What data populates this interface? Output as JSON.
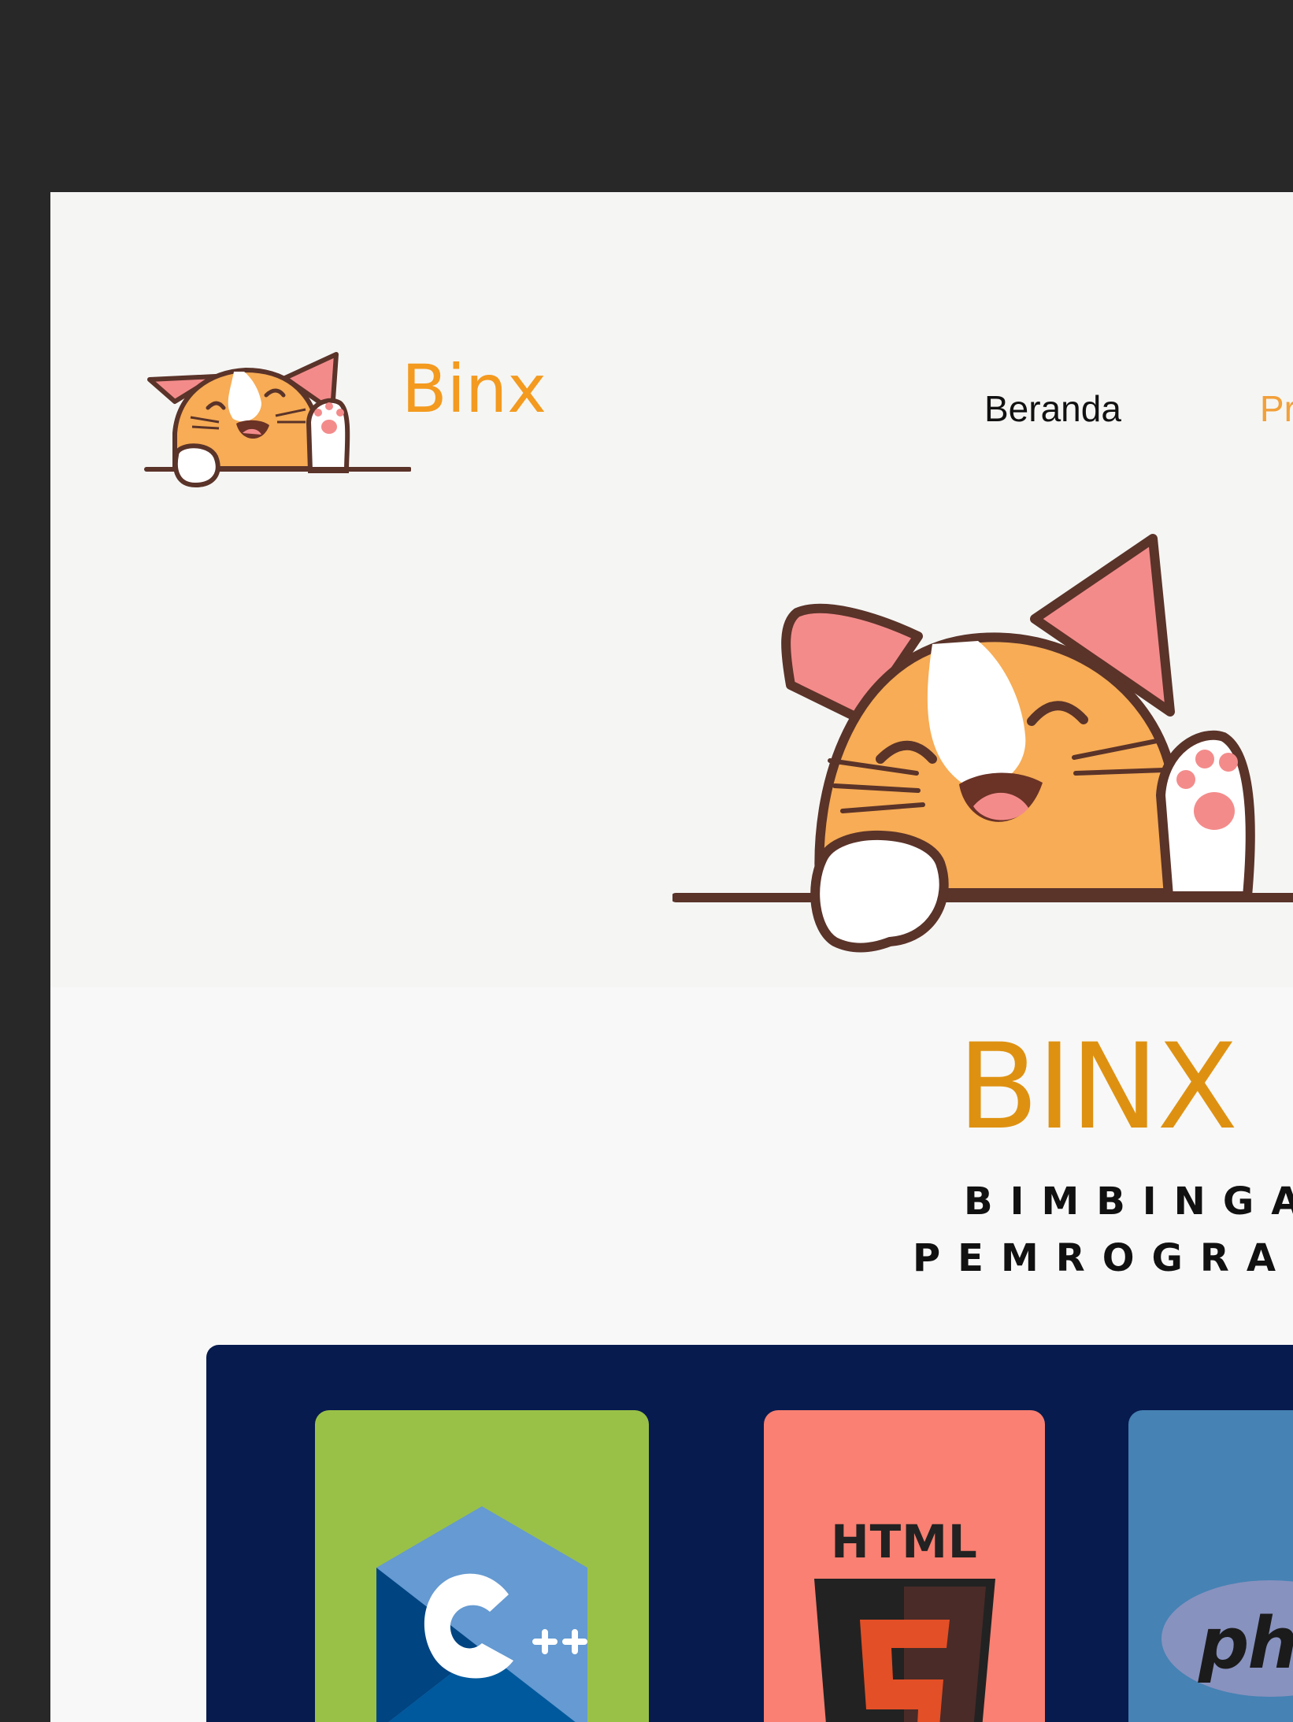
{
  "brand": {
    "name": "Binx",
    "logo_icon": "waving-cat-icon"
  },
  "nav": {
    "items": [
      {
        "label": "Beranda",
        "active": false
      },
      {
        "label": "Pro",
        "active": true
      }
    ]
  },
  "hero": {
    "illustration_icon": "waving-cat-icon",
    "title": "BINX",
    "subtitle_line1": "BIMBINGAN",
    "subtitle_line2": "PEMROGRAMA"
  },
  "languages": {
    "cards": [
      {
        "name": "C++",
        "icon": "cpp-logo-icon",
        "color": "#9ac147"
      },
      {
        "name": "HTML",
        "icon": "html5-logo-icon",
        "color": "#f98072"
      },
      {
        "name": "php",
        "icon": "php-logo-icon",
        "color": "#4682b4"
      }
    ]
  },
  "theme": {
    "window_bg": "#282828",
    "page_bg": "#f8f8f8",
    "brand_orange": "#f39a1f",
    "title_orange": "#de9111",
    "panel_navy": "#071b4e"
  }
}
